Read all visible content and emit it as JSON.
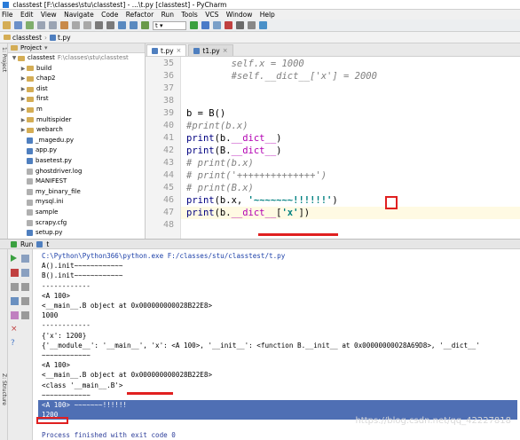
{
  "window": {
    "title": "classtest [F:\\classes\\stu\\classtest] - ...\\t.py [classtest] - PyCharm"
  },
  "menu": [
    "File",
    "Edit",
    "View",
    "Navigate",
    "Code",
    "Refactor",
    "Run",
    "Tools",
    "VCS",
    "Window",
    "Help"
  ],
  "toolbar": {
    "run_config_label": "t"
  },
  "breadcrumb": {
    "project": "classtest",
    "file": "t.py"
  },
  "left_stripe": {
    "project_label": "1: Project",
    "structure_label": "Z: Structure"
  },
  "project_panel": {
    "header": "Project",
    "root": {
      "name": "classtest",
      "path": "F:\\classes\\stu\\classtest"
    },
    "items": [
      {
        "name": "build",
        "type": "folder"
      },
      {
        "name": "chap2",
        "type": "folder"
      },
      {
        "name": "dist",
        "type": "folder"
      },
      {
        "name": "first",
        "type": "folder"
      },
      {
        "name": "m",
        "type": "folder"
      },
      {
        "name": "multispider",
        "type": "folder"
      },
      {
        "name": "webarch",
        "type": "folder"
      },
      {
        "name": "_magedu.py",
        "type": "py"
      },
      {
        "name": "app.py",
        "type": "py"
      },
      {
        "name": "basetest.py",
        "type": "py"
      },
      {
        "name": "ghostdriver.log",
        "type": "file"
      },
      {
        "name": "MANIFEST",
        "type": "file"
      },
      {
        "name": "my_binary_file",
        "type": "file"
      },
      {
        "name": "mysql.ini",
        "type": "file"
      },
      {
        "name": "sample",
        "type": "file"
      },
      {
        "name": "scrapy.cfg",
        "type": "file"
      },
      {
        "name": "setup.py",
        "type": "py"
      }
    ]
  },
  "editor": {
    "tabs": [
      {
        "label": "t.py",
        "active": true
      },
      {
        "label": "t1.py",
        "active": false
      }
    ],
    "lines": [
      {
        "num": "35",
        "text": "        self.x = 1000"
      },
      {
        "num": "36",
        "text": "        #self.__dict__['x'] = 2000"
      },
      {
        "num": "37",
        "text": ""
      },
      {
        "num": "38",
        "text": ""
      },
      {
        "num": "39",
        "text": "b = B()"
      },
      {
        "num": "40",
        "text": "#print(b.x)"
      },
      {
        "num": "41",
        "text": "print(b.__dict__)"
      },
      {
        "num": "42",
        "text": "print(B.__dict__)"
      },
      {
        "num": "43",
        "text": "# print(b.x)"
      },
      {
        "num": "44",
        "text": "# print('++++++++++++++')"
      },
      {
        "num": "45",
        "text": "# print(B.x)"
      },
      {
        "num": "46",
        "text": "print(b.x, '~~~~~~~!!!!!!')"
      },
      {
        "num": "47",
        "text": "print(b.__dict__['x'])"
      },
      {
        "num": "48",
        "text": ""
      }
    ]
  },
  "run_panel": {
    "header": "Run",
    "config": "t",
    "output": [
      "C:\\Python\\Python366\\python.exe F:/classes/stu/classtest/t.py",
      "A().init~~~~~~~~~~~~",
      "B().init~~~~~~~~~~~~",
      "------------",
      "<A 100>",
      "<__main__.B object at 0x000000000028B22E8>",
      "1000",
      "------------",
      "{'x': 1200}",
      "{'__module__': '__main__', 'x': <A 100>, '__init__': <function B.__init__ at 0x00000000028A69D8>, '__dict__'",
      "~~~~~~~~~~~~",
      "<A 100>",
      "<__main__.B object at 0x000000000028B22E8>",
      "<class '__main__.B'>",
      "~~~~~~~~~~~~",
      "<A 100> ~~~~~~~!!!!!!",
      "1200",
      "",
      "Process finished with exit code 0"
    ],
    "selected_lines": [
      15,
      16
    ]
  },
  "watermark": "https://blog.csdn.net/qq_42227818",
  "colors": {
    "accent_red": "#e02020",
    "selection": "#4f6fb4",
    "string": "#008080",
    "dunder": "#b200b2"
  }
}
